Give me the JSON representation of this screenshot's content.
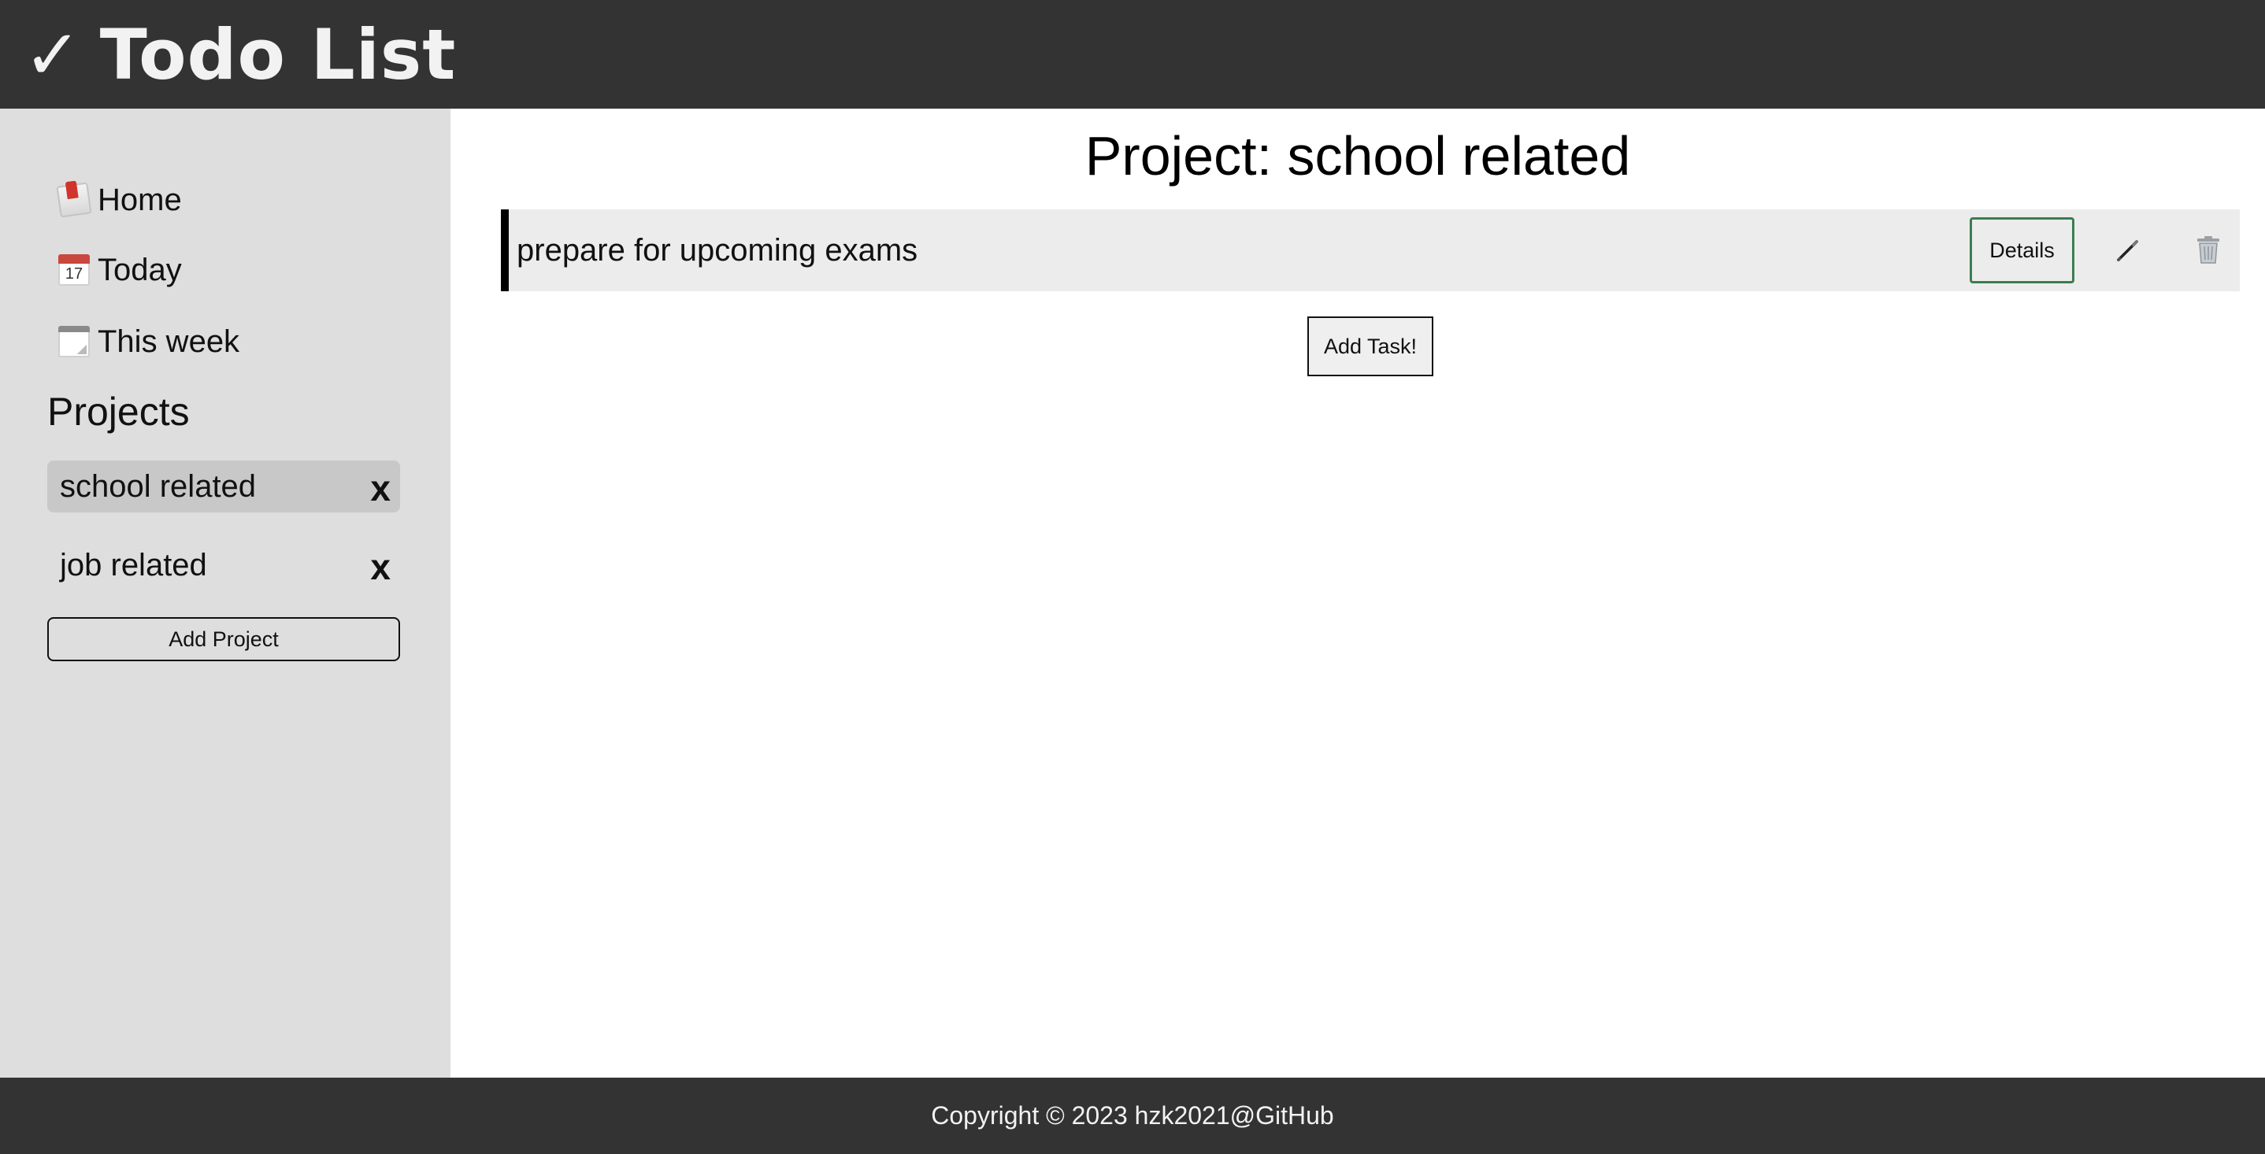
{
  "header": {
    "check_glyph": "✓",
    "title": "Todo List"
  },
  "sidebar": {
    "nav": [
      {
        "label": "Home",
        "icon": "mailbox-icon"
      },
      {
        "label": "Today",
        "icon": "calendar-icon",
        "icon_text": "17"
      },
      {
        "label": "This week",
        "icon": "spiral-calendar-icon"
      }
    ],
    "projects_title": "Projects",
    "projects": [
      {
        "name": "school related",
        "delete_label": "x",
        "active": true
      },
      {
        "name": "job related",
        "delete_label": "x",
        "active": false
      }
    ],
    "add_project_label": "Add Project"
  },
  "main": {
    "title": "Project: school related",
    "tasks": [
      {
        "title": "prepare for upcoming exams",
        "details_label": "Details",
        "edit_icon": "pencil-icon",
        "delete_icon": "trash-icon"
      }
    ],
    "add_task_label": "Add Task!"
  },
  "footer": {
    "text": "Copyright © 2023 hzk2021@GitHub"
  },
  "colors": {
    "header_bg": "#333333",
    "sidebar_bg": "#dedede",
    "active_project_bg": "#c8c8c8",
    "task_bg": "#ececec",
    "details_border": "#3a7d50"
  }
}
